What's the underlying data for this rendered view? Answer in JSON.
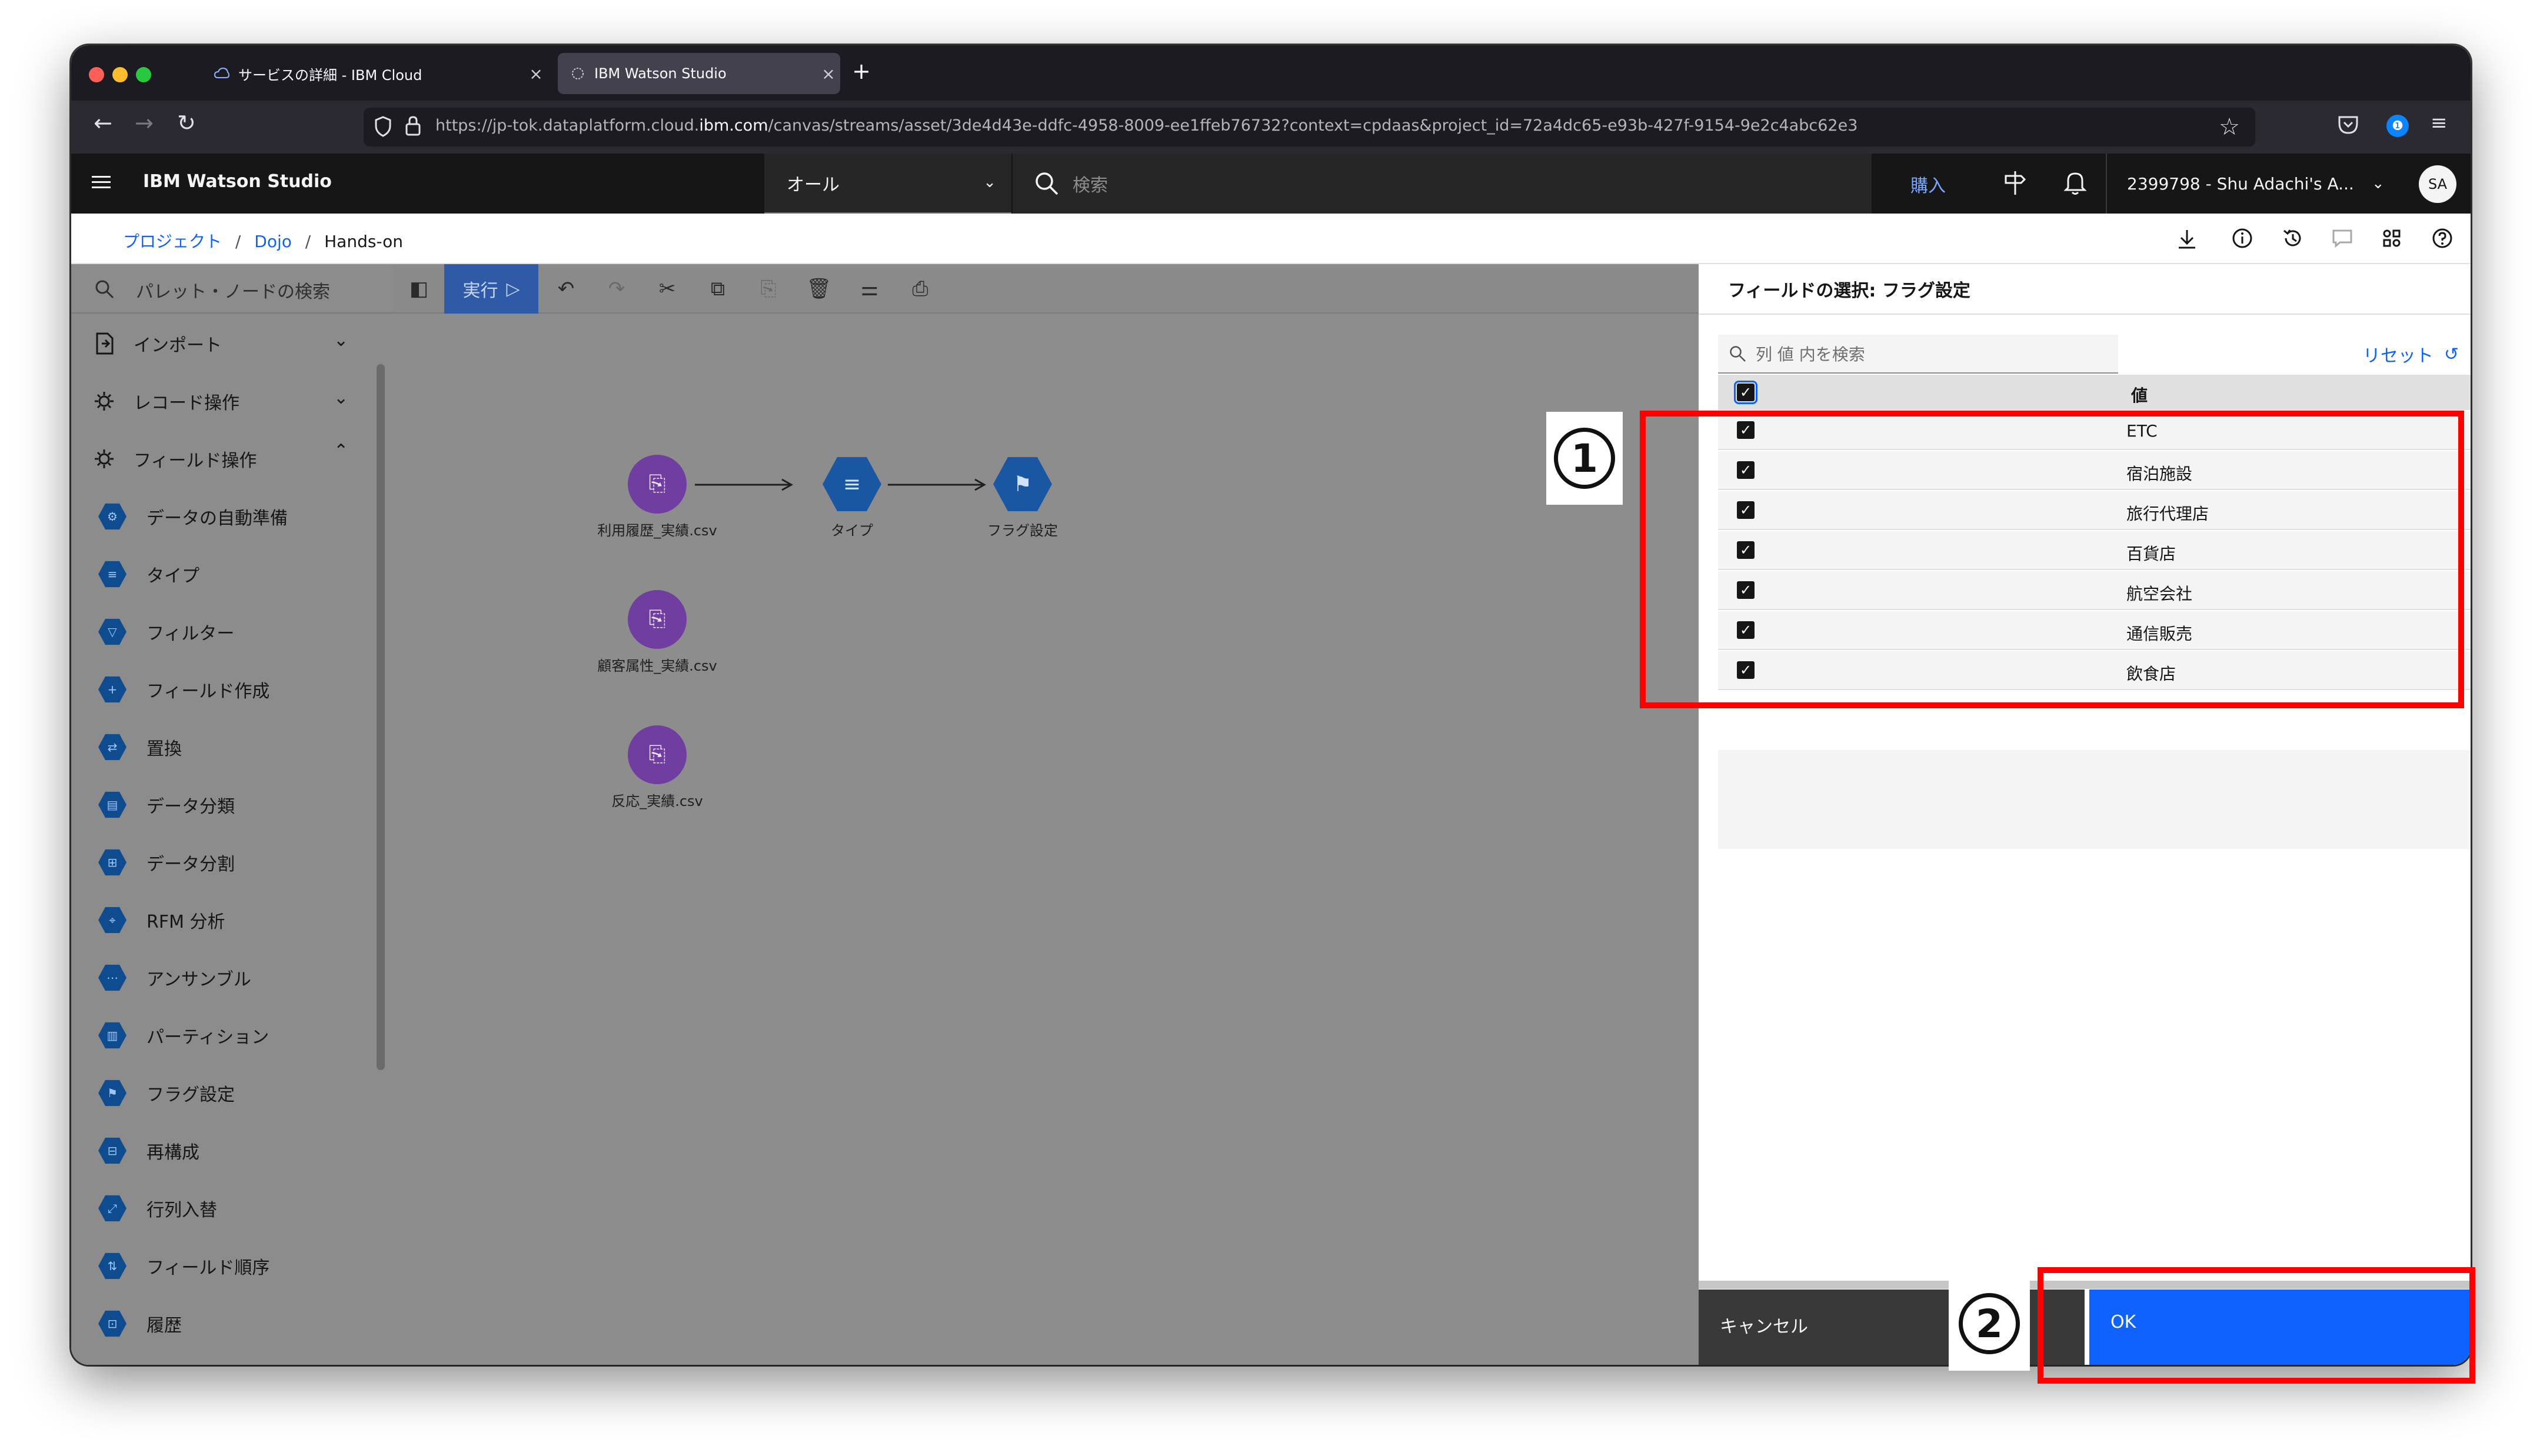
{
  "browser": {
    "tabs": [
      {
        "title": "サービスの詳細 - IBM Cloud",
        "icon": "ibm-cloud-icon",
        "active": false
      },
      {
        "title": "IBM Watson Studio",
        "icon": "watson-icon",
        "active": true
      }
    ],
    "new_tab": "+",
    "url_prefix": "https://jp-tok.dataplatform.cloud.",
    "url_domain": "ibm.com",
    "url_suffix": "/canvas/streams/asset/3de4d43e-ddfc-4958-8009-ee1ffeb76732?context=cpdaas&project_id=72a4dc65-e93b-427f-9154-9e2c4abc62e3"
  },
  "header": {
    "product": "IBM Watson Studio",
    "scope": "オール",
    "search_placeholder": "検索",
    "buy": "購入",
    "account": "2399798 - Shu Adachi's A...",
    "avatar": "SA"
  },
  "breadcrumb": {
    "items": [
      "プロジェクト",
      "Dojo"
    ],
    "separator": "/",
    "current": "Hands-on"
  },
  "palette": {
    "search_placeholder": "パレット・ノードの検索",
    "sections": [
      {
        "label": "インポート",
        "expanded": false
      },
      {
        "label": "レコード操作",
        "expanded": false
      },
      {
        "label": "フィールド操作",
        "expanded": true
      }
    ],
    "items": [
      "データの自動準備",
      "タイプ",
      "フィルター",
      "フィールド作成",
      "置換",
      "データ分類",
      "データ分割",
      "RFM 分析",
      "アンサンブル",
      "パーティション",
      "フラグ設定",
      "再構成",
      "行列入替",
      "フィールド順序",
      "履歴"
    ]
  },
  "toolbar": {
    "run": "実行"
  },
  "canvas": {
    "nodes": [
      {
        "label": "利用履歴_実績.csv",
        "kind": "csv"
      },
      {
        "label": "タイプ",
        "kind": "type"
      },
      {
        "label": "フラグ設定",
        "kind": "flag"
      },
      {
        "label": "顧客属性_実績.csv",
        "kind": "csv"
      },
      {
        "label": "反応_実績.csv",
        "kind": "csv"
      }
    ]
  },
  "panel": {
    "title": "フィールドの選択: フラグ設定",
    "search_placeholder": "列 値 内を検索",
    "reset": "リセット",
    "column_header": "値",
    "values": [
      "ETC",
      "宿泊施設",
      "旅行代理店",
      "百貨店",
      "航空会社",
      "通信販売",
      "飲食店"
    ],
    "all_checked": true,
    "cancel": "キャンセル",
    "ok": "OK"
  },
  "annotations": {
    "marker1": "1",
    "marker2": "2",
    "highlight_color": "#ff0000"
  }
}
